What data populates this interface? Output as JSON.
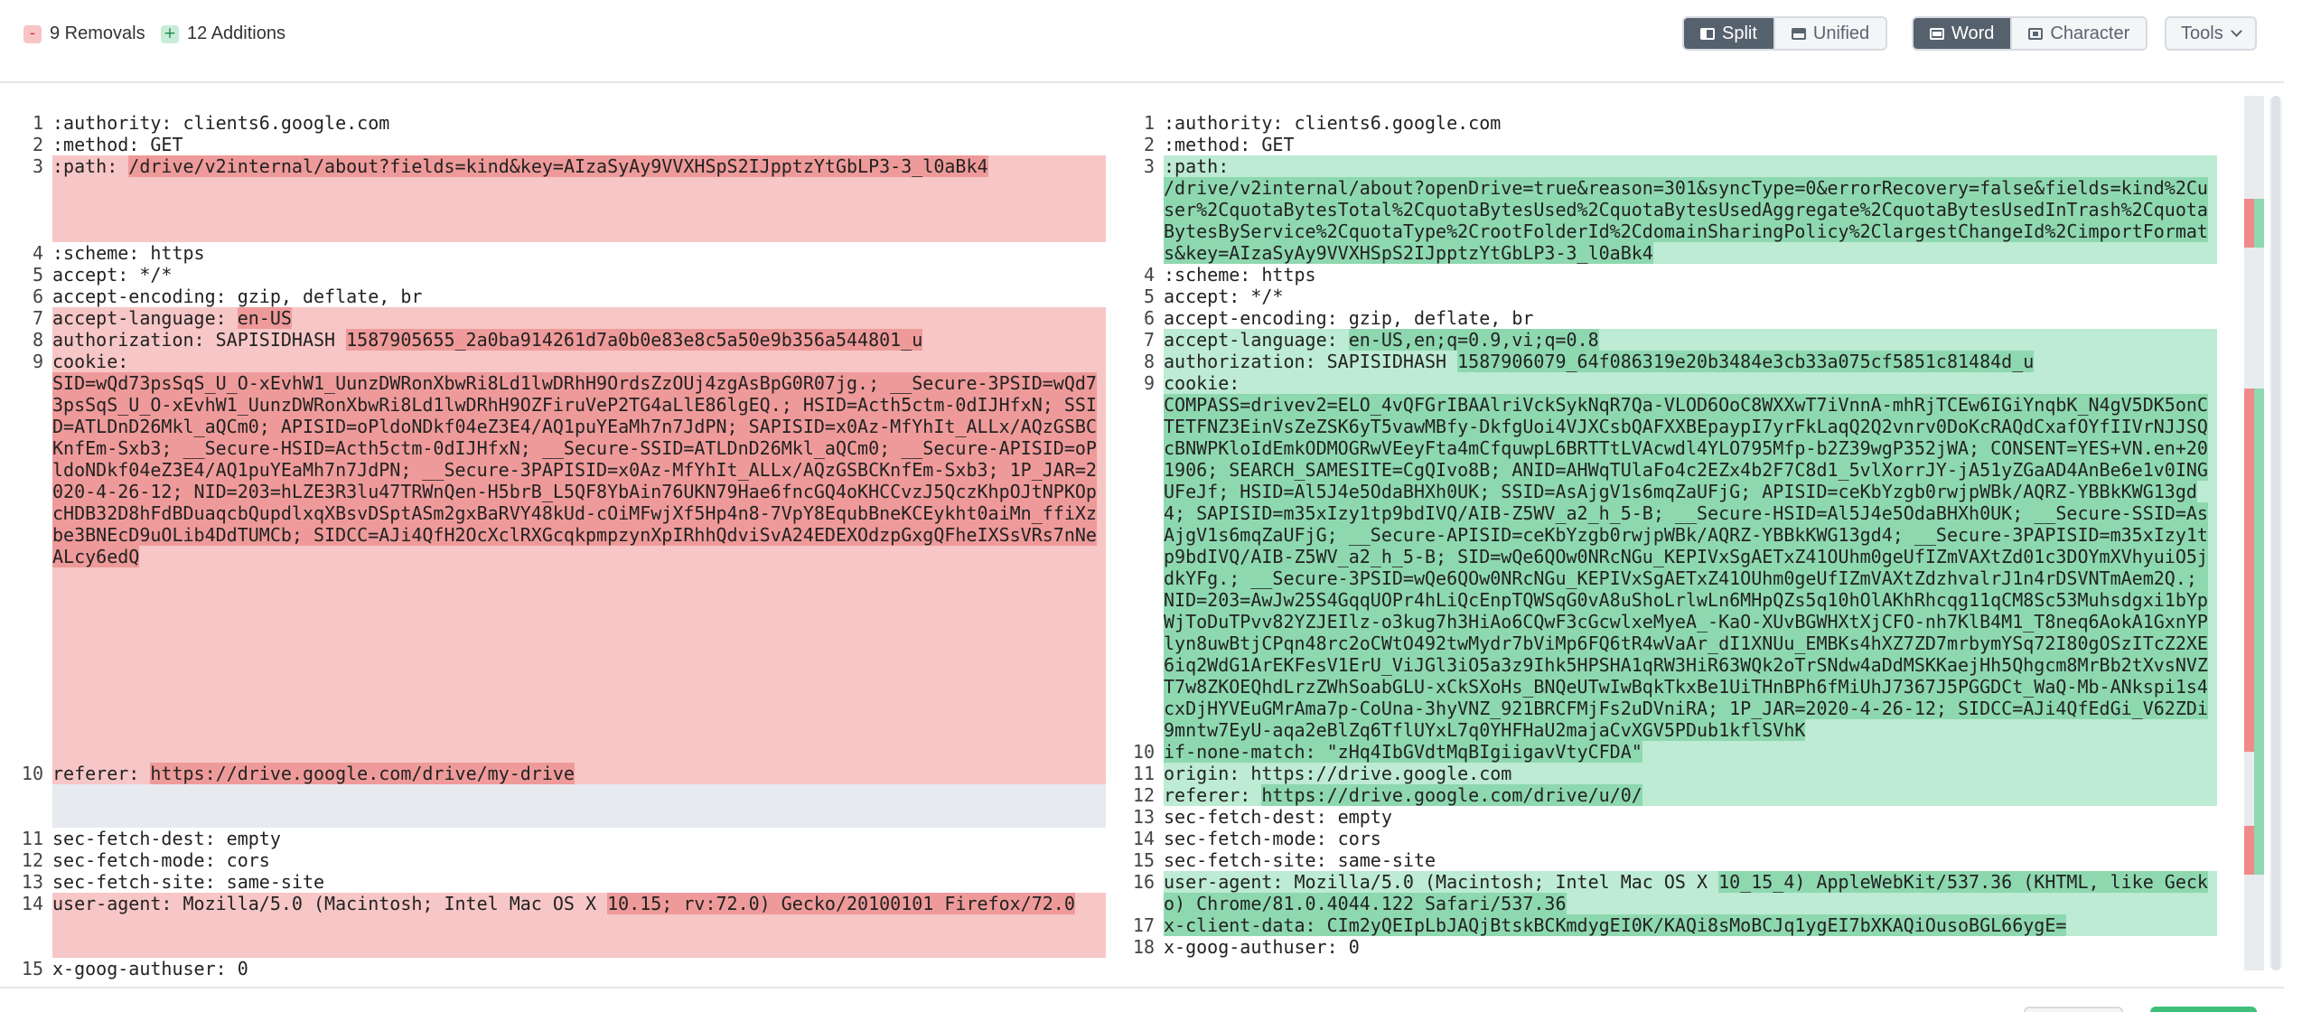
{
  "summary": {
    "removals": "9 Removals",
    "additions": "12 Additions",
    "removals_icon": "-",
    "additions_icon": "+"
  },
  "toolbar": {
    "split": "Split",
    "unified": "Unified",
    "word": "Word",
    "character": "Character",
    "tools": "Tools"
  },
  "colors": {
    "removed": "#f7c6c6",
    "removed_strong": "#ef9a9a",
    "added": "#bdebd3",
    "added_strong": "#8ed8b0",
    "active_button": "#56616e"
  },
  "left": [
    {
      "n": "1",
      "t": "ctx",
      "segs": [
        {
          "x": ":authority: clients6.google.com"
        }
      ]
    },
    {
      "n": "2",
      "t": "ctx",
      "segs": [
        {
          "x": ":method: GET"
        }
      ]
    },
    {
      "n": "3",
      "t": "del",
      "pad": 3,
      "segs": [
        {
          "x": ":path: "
        },
        {
          "x": "/drive/v2internal/about?fields=kind&key=AIzaSyAy9VVXHSpS2IJpptzYtGbLP3-3_l0aBk4",
          "h": 1
        }
      ]
    },
    {
      "n": "4",
      "t": "ctx",
      "segs": [
        {
          "x": ":scheme: https"
        }
      ]
    },
    {
      "n": "5",
      "t": "ctx",
      "segs": [
        {
          "x": "accept: */*"
        }
      ]
    },
    {
      "n": "6",
      "t": "ctx",
      "segs": [
        {
          "x": "accept-encoding: gzip, deflate, br"
        }
      ]
    },
    {
      "n": "7",
      "t": "del",
      "segs": [
        {
          "x": "accept-language: "
        },
        {
          "x": "en-US",
          "h": 1
        }
      ]
    },
    {
      "n": "8",
      "t": "del",
      "segs": [
        {
          "x": "authorization: SAPISIDHASH "
        },
        {
          "x": "1587905655_2a0ba914261d7a0b0e83e8c5a50e9b356a544801_u",
          "h": 1
        }
      ]
    },
    {
      "n": "9",
      "t": "del",
      "segs": [
        {
          "x": "cookie:"
        }
      ]
    },
    {
      "n": "",
      "t": "del",
      "pad": 9,
      "segs": [
        {
          "x": "SID=wQd73psSqS_U_O-xEvhW1_UunzDWRonXbwRi8Ld1lwDRhH9OrdsZzOUj4zgAsBpG0R07jg.; __Secure-3PSID=wQd73psSqS_U_O-xEvhW1_UunzDWRonXbwRi8Ld1lwDRhH9OZFiruVeP2TG4aLlE86lgEQ.; HSID=Acth5ctm-0dIJHfxN; SSID=ATLDnD26Mkl_aQCm0; APISID=oPldoNDkf04eZ3E4/AQ1puYEaMh7n7JdPN; SAPISID=x0Az-MfYhIt_ALLx/AQzGSBCKnfEm-Sxb3; __Secure-HSID=Acth5ctm-0dIJHfxN; __Secure-SSID=ATLDnD26Mkl_aQCm0; __Secure-APISID=oPldoNDkf04eZ3E4/AQ1puYEaMh7n7JdPN; __Secure-3PAPISID=x0Az-MfYhIt_ALLx/AQzGSBCKnfEm-Sxb3; 1P_JAR=2020-4-26-12; NID=203=hLZE3R3lu47TRWnQen-H5brB_L5QF8YbAin76UKN79Hae6fncGQ4oKHCCvzJ5QczKhpOJtNPKOpcHDB32D8hFdBDuaqcbQupdlxqXBsvDSptASm2gxBaRVY48kUd-cOiMFwjXf5Hp4n8-7VpY8EqubBneKCEykht0aiMn_ffiXzbe3BNEcD9uOLib4DdTUMCb; SIDCC=AJi4QfH2OcXclRXGcqkpmpzynXpIRhhQdviSvA24EDEXOdzpGxgQFheIXSsVRs7nNeALcy6edQ",
          "h": 1
        }
      ]
    },
    {
      "n": "10",
      "t": "del",
      "segs": [
        {
          "x": "referer: "
        },
        {
          "x": "https://drive.google.com/drive/my-drive",
          "h": 1
        }
      ]
    },
    {
      "n": "",
      "t": "blank",
      "pad": 2,
      "segs": []
    },
    {
      "n": "11",
      "t": "ctx",
      "segs": [
        {
          "x": "sec-fetch-dest: empty"
        }
      ]
    },
    {
      "n": "12",
      "t": "ctx",
      "segs": [
        {
          "x": "sec-fetch-mode: cors"
        }
      ]
    },
    {
      "n": "13",
      "t": "ctx",
      "segs": [
        {
          "x": "sec-fetch-site: same-site"
        }
      ]
    },
    {
      "n": "14",
      "t": "del",
      "pad": 2,
      "segs": [
        {
          "x": "user-agent: Mozilla/5.0 (Macintosh; Intel Mac OS X "
        },
        {
          "x": "10.15; rv:72.0) Gecko/20100101 Firefox/72.0",
          "h": 1
        }
      ]
    },
    {
      "n": "",
      "t": "blank",
      "segs": []
    },
    {
      "n": "15",
      "t": "ctx",
      "segs": [
        {
          "x": "x-goog-authuser: 0"
        }
      ]
    }
  ],
  "right": [
    {
      "n": "1",
      "t": "ctx",
      "segs": [
        {
          "x": ":authority: clients6.google.com"
        }
      ]
    },
    {
      "n": "2",
      "t": "ctx",
      "segs": [
        {
          "x": ":method: GET"
        }
      ]
    },
    {
      "n": "3",
      "t": "ins",
      "segs": [
        {
          "x": ":path:"
        }
      ]
    },
    {
      "n": "",
      "t": "ins",
      "segs": [
        {
          "x": "/drive/v2internal/about?openDrive=true&reason=301&syncType=0&errorRecovery=false&fields=kind%2Cuser%2CquotaBytesTotal%2CquotaBytesUsed%2CquotaBytesUsedAggregate%2CquotaBytesUsedInTrash%2CquotaBytesByService%2CquotaType%2CrootFolderId%2CdomainSharingPolicy%2ClargestChangeId%2CimportFormats&key=AIzaSyAy9VVXHSpS2IJpptzYtGbLP3-3_l0aBk4",
          "h": 1
        }
      ]
    },
    {
      "n": "4",
      "t": "ctx",
      "segs": [
        {
          "x": ":scheme: https"
        }
      ]
    },
    {
      "n": "5",
      "t": "ctx",
      "segs": [
        {
          "x": "accept: */*"
        }
      ]
    },
    {
      "n": "6",
      "t": "ctx",
      "segs": [
        {
          "x": "accept-encoding: gzip, deflate, br"
        }
      ]
    },
    {
      "n": "7",
      "t": "ins",
      "segs": [
        {
          "x": "accept-language: "
        },
        {
          "x": "en-US,en;q=0.9,vi;q=0.8",
          "h": 1
        }
      ]
    },
    {
      "n": "8",
      "t": "ins",
      "segs": [
        {
          "x": "authorization: SAPISIDHASH "
        },
        {
          "x": "1587906079_64f086319e20b3484e3cb33a075cf5851c81484d_u",
          "h": 1
        }
      ]
    },
    {
      "n": "9",
      "t": "ins",
      "segs": [
        {
          "x": "cookie:"
        }
      ]
    },
    {
      "n": "",
      "t": "ins",
      "segs": [
        {
          "x": "COMPASS=drivev2=ELO_4vQFGrIBAAlriVckSykNqR7Qa-VLOD6OoC8WXXwT7iVnnA-mhRjTCEw6IGiYnqbK_N4gV5DK5onCTETFNZ3EinVsZeZSK6yT5vawMBfy-DkfgUoi4VJXCsbQAFXXBEpaypI7yrFkLaqQ2Q2vnrv0DoKcRAQdCxafOYfIIVrNJJSQcBNWPKloIdEmkODMOGRwVEeyFta4mCfquwpL6BRTTtLVAcwdl4YLO795Mfp-b2Z39wgP352jWA; CONSENT=YES+VN.en+201906; SEARCH_SAMESITE=CgQIvo8B; ANID=AHWqTUlaFo4c2EZx4b2F7C8d1_5vlXorrJY-jA51yZGaAD4AnBe6e1v0INGUFeJf; HSID=Al5J4e5OdaBHXh0UK; SSID=AsAjgV1s6mqZaUFjG; APISID=ceKbYzgb0rwjpWBk/AQRZ-YBBkKWG13gd4; SAPISID=m35xIzy1tp9bdIVQ/AIB-Z5WV_a2_h_5-B; __Secure-HSID=Al5J4e5OdaBHXh0UK; __Secure-SSID=AsAjgV1s6mqZaUFjG; __Secure-APISID=ceKbYzgb0rwjpWBk/AQRZ-YBBkKWG13gd4; __Secure-3PAPISID=m35xIzy1tp9bdIVQ/AIB-Z5WV_a2_h_5-B; SID=wQe6QOw0NRcNGu_KEPIVxSgAETxZ41OUhm0geUfIZmVAXtZd01c3DOYmXVhyuiO5jdkYFg.; __Secure-3PSID=wQe6QOw0NRcNGu_KEPIVxSgAETxZ41OUhm0geUfIZmVAXtZdzhvalrJ1n4rDSVNTmAem2Q.; NID=203=AwJw25S4GqqUOPr4hLiQcEnpTQWSqG0vA8uShoLrlwLn6MHpQZs5q10hOlAKhRhcqg11qCM8Sc53Muhsdgxi1bYpWjToDuTPvv82YZJEIlz-o3kug7h3HiAo6CQwF3cGcwlxeMyeA_-KaO-XUvBGWHXtXjCFO-nh7KlB4M1_T8neq6AokA1GxnYPlyn8uwBtjCPqn48rc2oCWtO492twMydr7bViMp6FQ6tR4wVaAr_dI1XNUu_EMBKs4hXZ7ZD7mrbymYSq72I80gOSzITcZ2XE6iq2WdG1ArEKFesV1ErU_ViJGl3iO5a3z9Ihk5HPSHA1qRW3HiR63WQk2oTrSNdw4aDdMSKKaejHh5Qhgcm8MrBb2tXvsNVZT7w8ZKOEQhdLrzZWhSoabGLU-xCkSXoHs_BNQeUTwIwBqkTkxBe1UiTHnBPh6fMiUhJ7367J5PGGDCt_WaQ-Mb-ANkspi1s4cxDjHYVEuGMrAma7p-CoUna-3hyVNZ_921BRCFMjFs2uDVniRA; 1P_JAR=2020-4-26-12; SIDCC=AJi4QfEdGi_V62ZDi9mntw7EyU-aqa2eBlZq6TflUYxL7q0YHFHaU2majaCvXGV5PDub1kflSVhK",
          "h": 1
        }
      ]
    },
    {
      "n": "10",
      "t": "ins",
      "segs": [
        {
          "x": "if-none-match: \"zHq4IbGVdtMqBIgiigavVtyCFDA\"",
          "h": 1
        }
      ]
    },
    {
      "n": "11",
      "t": "ins",
      "segs": [
        {
          "x": "origin: https://drive.google.com"
        }
      ]
    },
    {
      "n": "12",
      "t": "ins",
      "segs": [
        {
          "x": "referer: "
        },
        {
          "x": "https://drive.google.com/drive/u/0/",
          "h": 1
        }
      ]
    },
    {
      "n": "13",
      "t": "ctx",
      "segs": [
        {
          "x": "sec-fetch-dest: empty"
        }
      ]
    },
    {
      "n": "14",
      "t": "ctx",
      "segs": [
        {
          "x": "sec-fetch-mode: cors"
        }
      ]
    },
    {
      "n": "15",
      "t": "ctx",
      "segs": [
        {
          "x": "sec-fetch-site: same-site"
        }
      ]
    },
    {
      "n": "16",
      "t": "ins",
      "segs": [
        {
          "x": "user-agent: Mozilla/5.0 (Macintosh; Intel Mac OS X "
        },
        {
          "x": "10_15_4) AppleWebKit/537.36 (KHTML, like Gecko) Chrome/81.0.4044.122 Safari/537.36",
          "h": 1
        }
      ]
    },
    {
      "n": "17",
      "t": "ins",
      "segs": [
        {
          "x": "x-client-data: CIm2yQEIpLbJAQjBtskBCKmdygEI0K/KAQi8sMoBCJq1ygEI7bXKAQiOusoBGL66ygE=",
          "h": 1
        }
      ]
    },
    {
      "n": "18",
      "t": "ctx",
      "segs": [
        {
          "x": "x-goog-authuser: 0"
        }
      ]
    }
  ]
}
